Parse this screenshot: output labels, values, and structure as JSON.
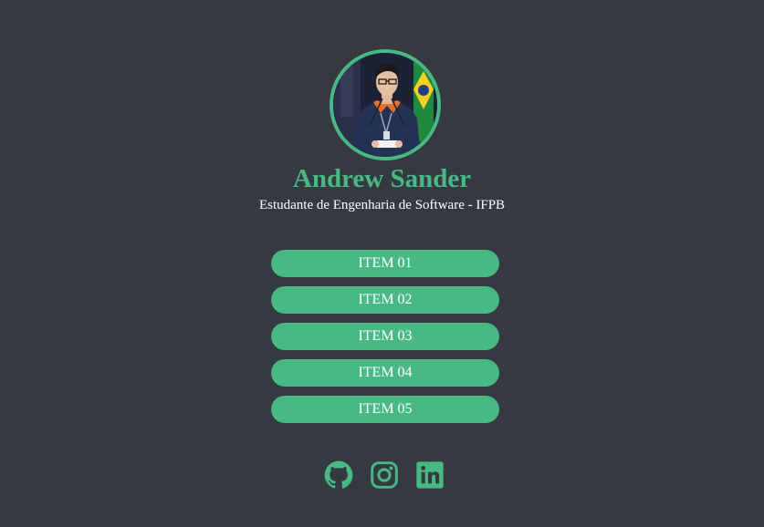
{
  "profile": {
    "name": "Andrew Sander",
    "subtitle": "Estudante de Engenharia de Software - IFPB",
    "avatar_alt": "Andrew Sander"
  },
  "links": [
    {
      "label": "ITEM 01"
    },
    {
      "label": "ITEM 02"
    },
    {
      "label": "ITEM 03"
    },
    {
      "label": "ITEM 04"
    },
    {
      "label": "ITEM 05"
    }
  ],
  "social": [
    {
      "icon": "github-icon"
    },
    {
      "icon": "instagram-icon"
    },
    {
      "icon": "linkedin-icon"
    }
  ],
  "colors": {
    "background": "#343a40",
    "accent": "#48b884",
    "text": "#ffffff"
  }
}
